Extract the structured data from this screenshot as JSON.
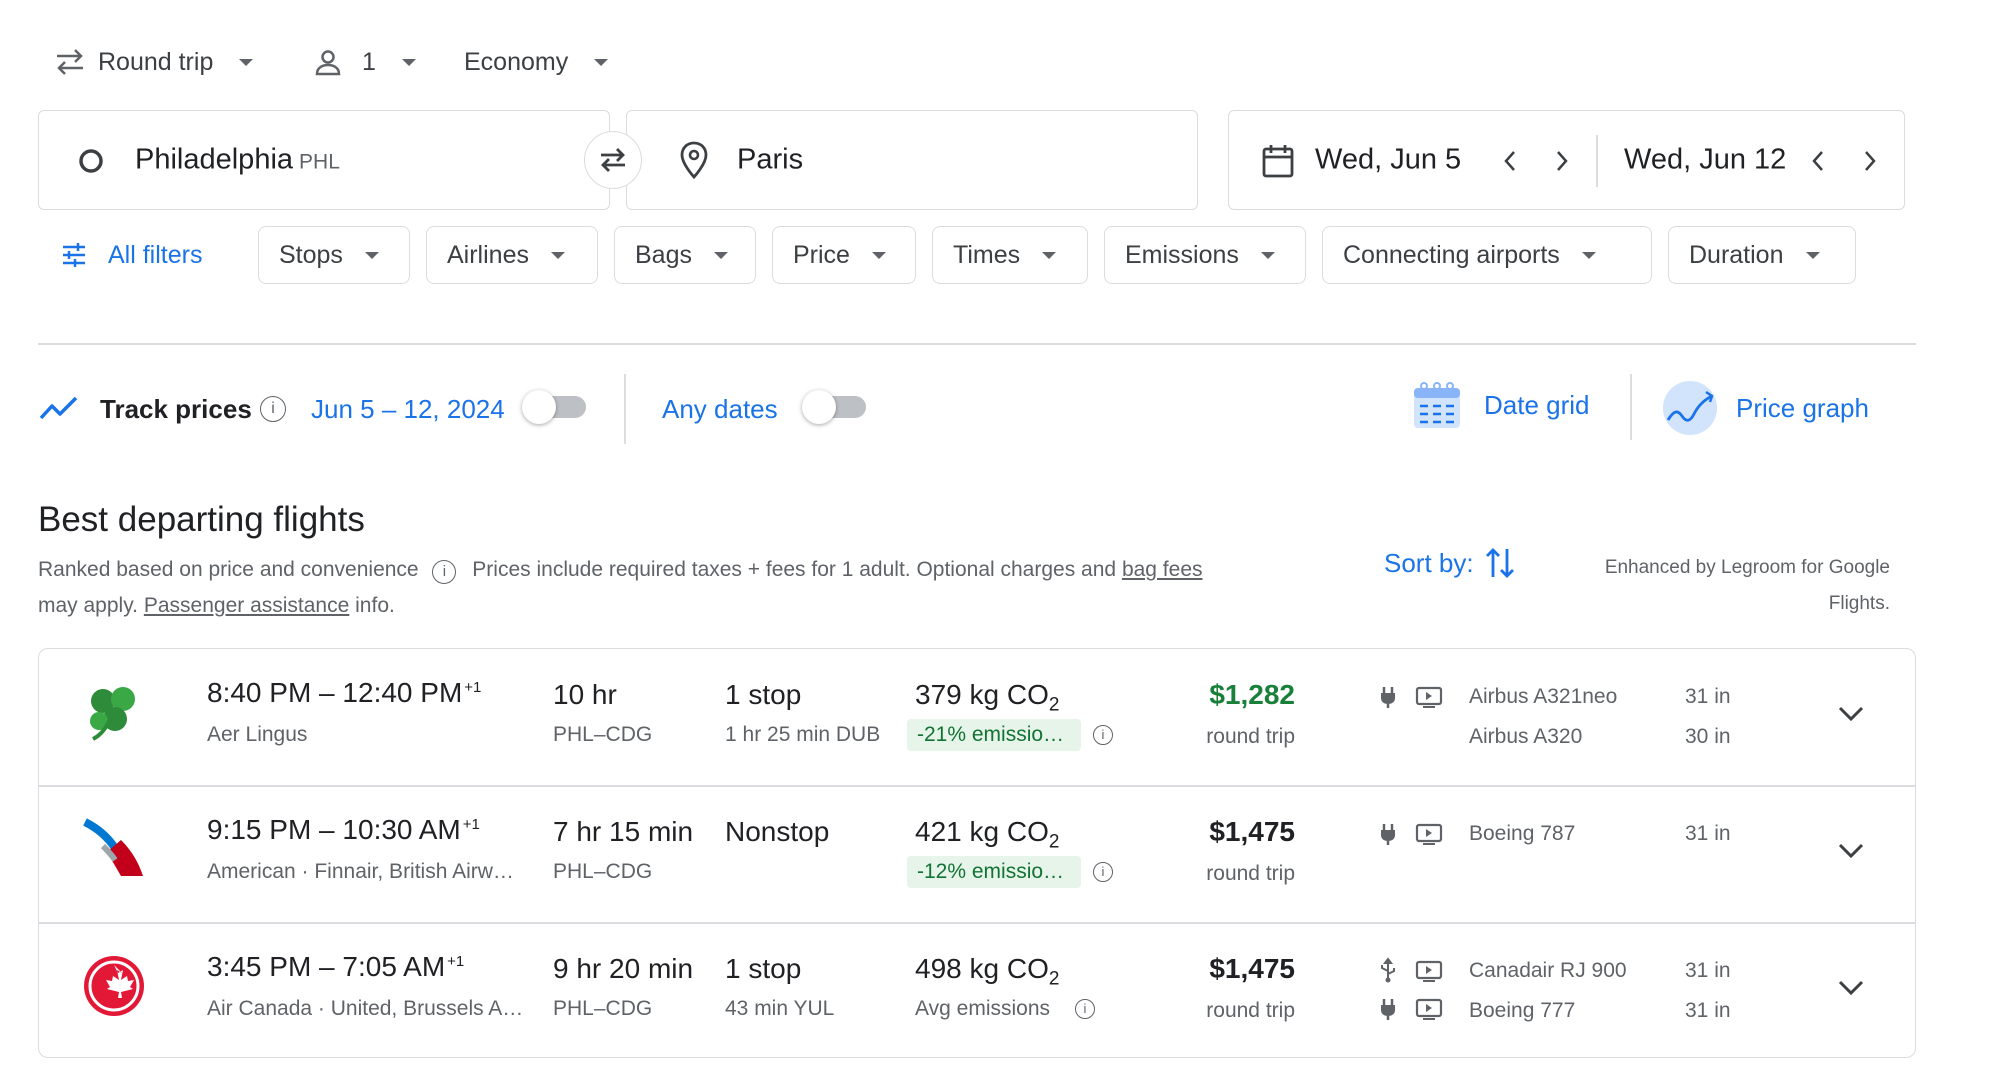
{
  "top": {
    "trip_type": "Round trip",
    "passengers": "1",
    "cabin": "Economy"
  },
  "search": {
    "origin": "Philadelphia",
    "origin_code": "PHL",
    "destination": "Paris",
    "depart_date": "Wed, Jun 5",
    "return_date": "Wed, Jun 12"
  },
  "filters": {
    "all_filters": "All filters",
    "chips": [
      "Stops",
      "Airlines",
      "Bags",
      "Price",
      "Times",
      "Emissions",
      "Connecting airports",
      "Duration"
    ]
  },
  "track": {
    "label": "Track prices",
    "dates": "Jun 5 – 12, 2024",
    "any_dates": "Any dates",
    "date_grid": "Date grid",
    "price_graph": "Price graph"
  },
  "results_header": {
    "title": "Best departing flights",
    "ranked": "Ranked based on price and convenience",
    "prices_note": "Prices include required taxes + fees for 1 adult. Optional charges and",
    "bag_fees": "bag fees",
    "may_apply": "may apply.",
    "passenger_assistance": "Passenger assistance",
    "info": "info.",
    "sort_by": "Sort by:",
    "enhanced": "Enhanced by Legroom for Google Flights."
  },
  "flights": [
    {
      "depart": "8:40 PM",
      "arrive": "12:40 PM",
      "day_offset": "+1",
      "airline": "Aer Lingus",
      "duration": "10 hr",
      "route": "PHL–CDG",
      "stops": "1 stop",
      "layover": "1 hr 25 min DUB",
      "co2": "379 kg CO",
      "co2_sub": "2",
      "emissions": "-21% emissio…",
      "price": "$1,282",
      "price_color": "#188038",
      "price_note": "round trip",
      "aircraft": [
        "Airbus A321neo",
        "Airbus A320"
      ],
      "legroom": [
        "31 in",
        "30 in"
      ]
    },
    {
      "depart": "9:15 PM",
      "arrive": "10:30 AM",
      "day_offset": "+1",
      "airline": "American · Finnair, British Airw…",
      "duration": "7 hr 15 min",
      "route": "PHL–CDG",
      "stops": "Nonstop",
      "layover": "",
      "co2": "421 kg CO",
      "co2_sub": "2",
      "emissions": "-12% emissio…",
      "price": "$1,475",
      "price_color": "#202124",
      "price_note": "round trip",
      "aircraft": [
        "Boeing 787"
      ],
      "legroom": [
        "31 in"
      ]
    },
    {
      "depart": "3:45 PM",
      "arrive": "7:05 AM",
      "day_offset": "+1",
      "airline": "Air Canada · United, Brussels A…",
      "duration": "9 hr 20 min",
      "route": "PHL–CDG",
      "stops": "1 stop",
      "layover": "43 min YUL",
      "co2": "498 kg CO",
      "co2_sub": "2",
      "emissions": "Avg emissions",
      "price": "$1,475",
      "price_color": "#202124",
      "price_note": "round trip",
      "aircraft": [
        "Canadair RJ 900",
        "Boeing 777"
      ],
      "legroom": [
        "31 in",
        "31 in"
      ]
    }
  ]
}
